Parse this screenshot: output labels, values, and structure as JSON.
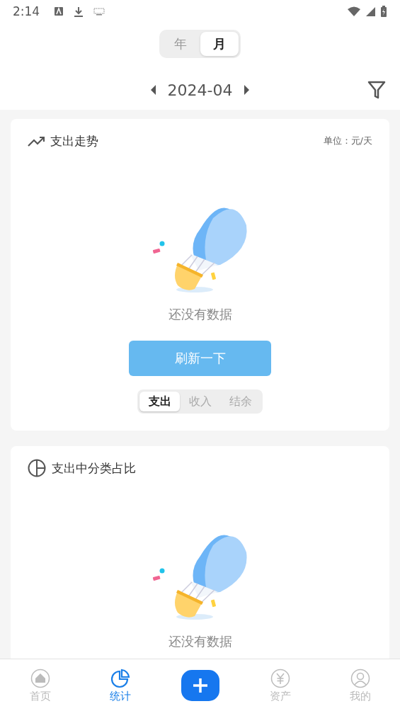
{
  "status_bar": {
    "time": "2:14"
  },
  "period_toggle": [
    {
      "label": "年",
      "selected": false
    },
    {
      "label": "月",
      "selected": true
    }
  ],
  "date_nav": {
    "value": "2024-04"
  },
  "cards": [
    {
      "kind": "trend",
      "title": "支出走势",
      "unit": "单位：元/天",
      "empty_text": "还没有数据",
      "refresh_button": "刷新一下",
      "segments": [
        {
          "label": "支出",
          "selected": true
        },
        {
          "label": "收入",
          "selected": false
        },
        {
          "label": "结余",
          "selected": false
        }
      ]
    },
    {
      "kind": "pie",
      "title": "支出中分类占比",
      "empty_text": "还没有数据"
    }
  ],
  "bottom_nav": [
    {
      "kind": "home",
      "label": "首页",
      "selected": false
    },
    {
      "kind": "stats",
      "label": "统计",
      "selected": true
    },
    {
      "kind": "add",
      "selected": false
    },
    {
      "kind": "assets",
      "label": "资产",
      "selected": false
    },
    {
      "kind": "profile",
      "label": "我的",
      "selected": false
    }
  ]
}
